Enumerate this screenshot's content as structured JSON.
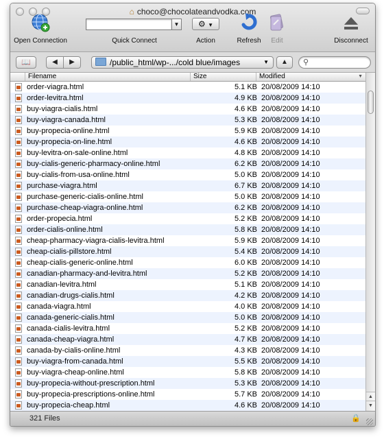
{
  "window": {
    "title": "choco@chocolateandvodka.com"
  },
  "toolbar": {
    "open_connection": "Open Connection",
    "quick_connect": "Quick Connect",
    "quick_connect_value": "",
    "action": "Action",
    "refresh": "Refresh",
    "edit": "Edit",
    "disconnect": "Disconnect"
  },
  "navbar": {
    "path": "/public_html/wp-.../cold blue/images",
    "search_value": ""
  },
  "columns": {
    "filename": "Filename",
    "size": "Size",
    "modified": "Modified"
  },
  "files": [
    {
      "name": "order-viagra.html",
      "size": "5.1 KB",
      "modified": "20/08/2009 14:10"
    },
    {
      "name": "order-levitra.html",
      "size": "4.9 KB",
      "modified": "20/08/2009 14:10"
    },
    {
      "name": "buy-viagra-cialis.html",
      "size": "4.6 KB",
      "modified": "20/08/2009 14:10"
    },
    {
      "name": "buy-viagra-canada.html",
      "size": "5.3 KB",
      "modified": "20/08/2009 14:10"
    },
    {
      "name": "buy-propecia-online.html",
      "size": "5.9 KB",
      "modified": "20/08/2009 14:10"
    },
    {
      "name": "buy-propecia-on-line.html",
      "size": "4.6 KB",
      "modified": "20/08/2009 14:10"
    },
    {
      "name": "buy-levitra-on-sale-online.html",
      "size": "4.8 KB",
      "modified": "20/08/2009 14:10"
    },
    {
      "name": "buy-cialis-generic-pharmacy-online.html",
      "size": "6.2 KB",
      "modified": "20/08/2009 14:10"
    },
    {
      "name": "buy-cialis-from-usa-online.html",
      "size": "5.0 KB",
      "modified": "20/08/2009 14:10"
    },
    {
      "name": "purchase-viagra.html",
      "size": "6.7 KB",
      "modified": "20/08/2009 14:10"
    },
    {
      "name": "purchase-generic-cialis-online.html",
      "size": "5.0 KB",
      "modified": "20/08/2009 14:10"
    },
    {
      "name": "purchase-cheap-viagra-online.html",
      "size": "6.2 KB",
      "modified": "20/08/2009 14:10"
    },
    {
      "name": "order-propecia.html",
      "size": "5.2 KB",
      "modified": "20/08/2009 14:10"
    },
    {
      "name": "order-cialis-online.html",
      "size": "5.8 KB",
      "modified": "20/08/2009 14:10"
    },
    {
      "name": "cheap-pharmacy-viagra-cialis-levitra.html",
      "size": "5.9 KB",
      "modified": "20/08/2009 14:10"
    },
    {
      "name": "cheap-cialis-pillstore.html",
      "size": "5.4 KB",
      "modified": "20/08/2009 14:10"
    },
    {
      "name": "cheap-cialis-generic-online.html",
      "size": "6.0 KB",
      "modified": "20/08/2009 14:10"
    },
    {
      "name": "canadian-pharmacy-and-levitra.html",
      "size": "5.2 KB",
      "modified": "20/08/2009 14:10"
    },
    {
      "name": "canadian-levitra.html",
      "size": "5.1 KB",
      "modified": "20/08/2009 14:10"
    },
    {
      "name": "canadian-drugs-cialis.html",
      "size": "4.2 KB",
      "modified": "20/08/2009 14:10"
    },
    {
      "name": "canada-viagra.html",
      "size": "4.0 KB",
      "modified": "20/08/2009 14:10"
    },
    {
      "name": "canada-generic-cialis.html",
      "size": "5.0 KB",
      "modified": "20/08/2009 14:10"
    },
    {
      "name": "canada-cialis-levitra.html",
      "size": "5.2 KB",
      "modified": "20/08/2009 14:10"
    },
    {
      "name": "canada-cheap-viagra.html",
      "size": "4.7 KB",
      "modified": "20/08/2009 14:10"
    },
    {
      "name": "canada-by-cialis-online.html",
      "size": "4.3 KB",
      "modified": "20/08/2009 14:10"
    },
    {
      "name": "buy-viagra-from-canada.html",
      "size": "5.5 KB",
      "modified": "20/08/2009 14:10"
    },
    {
      "name": "buy-viagra-cheap-online.html",
      "size": "5.8 KB",
      "modified": "20/08/2009 14:10"
    },
    {
      "name": "buy-propecia-without-prescription.html",
      "size": "5.3 KB",
      "modified": "20/08/2009 14:10"
    },
    {
      "name": "buy-propecia-prescriptions-online.html",
      "size": "5.7 KB",
      "modified": "20/08/2009 14:10"
    },
    {
      "name": "buy-propecia-cheap.html",
      "size": "4.6 KB",
      "modified": "20/08/2009 14:10"
    }
  ],
  "status": {
    "count": "321 Files"
  },
  "colors": {
    "alt_row": "#edf3fe",
    "file_icon_accent": "#cc5a1e",
    "refresh_blue": "#2f6fd0",
    "edit_purple": "#8a6fb8"
  },
  "icons": {
    "open_connection": "globe-plus-icon",
    "action": "gear-icon",
    "refresh": "refresh-arrow-icon",
    "edit": "edit-icon",
    "disconnect": "eject-icon",
    "bookmarks": "book-icon",
    "back": "back-arrow-icon",
    "forward": "forward-arrow-icon",
    "up": "up-arrow-icon",
    "search": "magnifier-icon",
    "file": "html-file-icon",
    "lock": "lock-icon"
  }
}
